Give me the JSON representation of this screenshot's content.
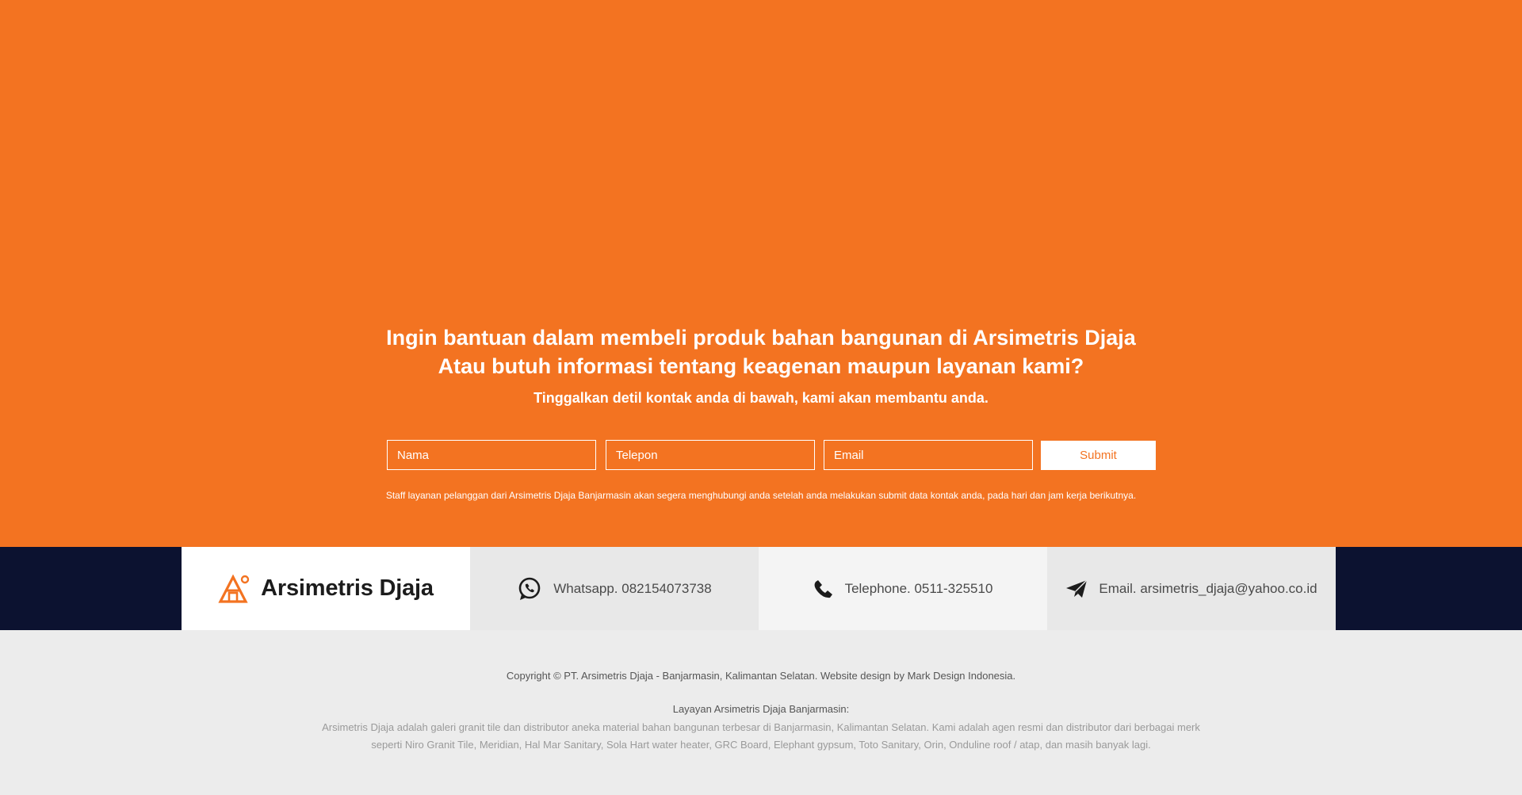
{
  "cta": {
    "title_line1": "Ingin bantuan dalam membeli produk bahan bangunan di Arsimetris Djaja",
    "title_line2": "Atau butuh informasi tentang keagenan maupun layanan kami?",
    "subtitle": "Tinggalkan detil kontak anda di bawah, kami akan membantu anda.",
    "form": {
      "nama_placeholder": "Nama",
      "telepon_placeholder": "Telepon",
      "email_placeholder": "Email",
      "submit_label": "Submit"
    },
    "note": "Staff layanan pelanggan dari Arsimetris Djaja Banjarmasin akan segera menghubungi anda setelah anda melakukan submit data kontak anda, pada hari dan jam kerja berikutnya."
  },
  "contact_bar": {
    "brand": "Arsimetris Djaja",
    "whatsapp": "Whatsapp. 082154073738",
    "telephone": "Telephone. 0511-325510",
    "email": "Email. arsimetris_djaja@yahoo.co.id"
  },
  "footer": {
    "copyright": "Copyright © PT. Arsimetris Djaja - Banjarmasin, Kalimantan Selatan. Website design by Mark Design Indonesia.",
    "about_title": "Layayan Arsimetris Djaja Banjarmasin:",
    "about_text": "Arsimetris Djaja adalah galeri granit tile dan distributor aneka material bahan bangunan terbesar di Banjarmasin, Kalimantan Selatan. Kami adalah agen resmi dan distributor dari berbagai merk seperti Niro Granit Tile, Meridian, Hal Mar Sanitary, Sola Hart water heater, GRC Board, Elephant gypsum, Toto Sanitary, Orin, Onduline roof / atap, dan masih banyak lagi."
  },
  "icons": {
    "logo": "house-logo-icon",
    "whatsapp": "whatsapp-icon",
    "telephone": "phone-icon",
    "email": "paper-plane-icon"
  },
  "colors": {
    "accent": "#f37321",
    "dark_band": "#0c1230",
    "footer_bg": "#ececec"
  }
}
